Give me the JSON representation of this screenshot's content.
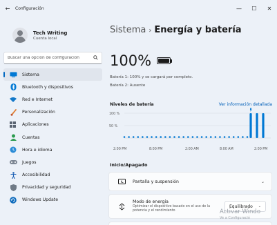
{
  "window": {
    "title": "Configuración",
    "back_glyph": "←",
    "minimize_glyph": "—",
    "maximize_glyph": "☐",
    "close_glyph": "✕"
  },
  "profile": {
    "name": "Tech Writing",
    "subtitle": "Cuenta local"
  },
  "search": {
    "placeholder": "Buscar una opción de configuración",
    "icon": "search-icon"
  },
  "sidebar": {
    "items": [
      {
        "label": "Sistema",
        "icon": "monitor-icon",
        "active": true
      },
      {
        "label": "Bluetooth y dispositivos",
        "icon": "bluetooth-icon"
      },
      {
        "label": "Red e Internet",
        "icon": "wifi-icon"
      },
      {
        "label": "Personalización",
        "icon": "brush-icon"
      },
      {
        "label": "Aplicaciones",
        "icon": "apps-icon"
      },
      {
        "label": "Cuentas",
        "icon": "account-icon"
      },
      {
        "label": "Hora e idioma",
        "icon": "globe-clock-icon"
      },
      {
        "label": "Juegos",
        "icon": "gamepad-icon"
      },
      {
        "label": "Accesibilidad",
        "icon": "accessibility-icon"
      },
      {
        "label": "Privacidad y seguridad",
        "icon": "shield-icon"
      },
      {
        "label": "Windows Update",
        "icon": "update-icon"
      }
    ]
  },
  "header": {
    "crumb1": "Sistema",
    "separator": "›",
    "crumb2": "Energía y batería"
  },
  "battery": {
    "percent": "100%",
    "battery1": "Batería 1: 100% y se cargará por completo.",
    "battery2": "Batería 2: Ausente"
  },
  "levels": {
    "title": "Niveles de batería",
    "link": "Ver información detallada",
    "chart_data": {
      "type": "bar",
      "y_ticks": [
        "100 %",
        "50 %"
      ],
      "x_ticks": [
        "2:00 PM",
        "8:00 PM",
        "2:00 AM",
        "8:00 AM",
        "2:00 PM"
      ],
      "ylim": [
        0,
        100
      ],
      "bars": [
        100,
        100,
        100
      ],
      "dots": 28,
      "accent": "#0078d4"
    }
  },
  "power": {
    "section_title": "Inicio/Apagado",
    "screen_sleep": "Pantalla y suspensión",
    "mode_title": "Modo de energía",
    "mode_desc": "Optimizar el dispositivo basado en el uso de la potencia y el rendimiento",
    "mode_value": "Equilibrado"
  },
  "watermark": {
    "line1": "Activar Windo",
    "line2": "Ve a Configuració"
  }
}
